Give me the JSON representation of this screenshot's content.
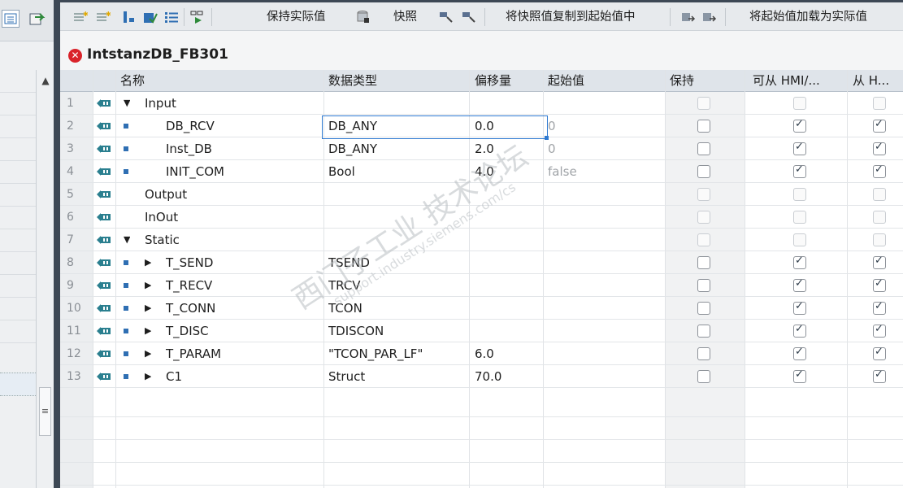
{
  "toolbar": {
    "keep_actual": "保持实际值",
    "snapshot": "快照",
    "copy_snapshot": "将快照值复制到起始值中",
    "load_start": "将起始值加载为实际值"
  },
  "block": {
    "title": "IntstanzDB_FB301",
    "status": "error"
  },
  "table": {
    "headers": {
      "name": "名称",
      "datatype": "数据类型",
      "offset": "偏移量",
      "start": "起始值",
      "retain": "保持",
      "hmi_access": "可从 HMI/...",
      "hmi_visible": "从 H..."
    },
    "rows": [
      {
        "num": "1",
        "name": "Input",
        "type": "",
        "offset": "",
        "start": "",
        "level": 0,
        "expand": "open",
        "bullet": false,
        "cbs": [
          false,
          false,
          false
        ],
        "enabled": false
      },
      {
        "num": "2",
        "name": "DB_RCV",
        "type": "DB_ANY",
        "offset": "0.0",
        "start": "0",
        "level": 1,
        "expand": "none",
        "bullet": true,
        "cbs": [
          false,
          true,
          true
        ],
        "enabled": true
      },
      {
        "num": "3",
        "name": "Inst_DB",
        "type": "DB_ANY",
        "offset": "2.0",
        "start": "0",
        "level": 1,
        "expand": "none",
        "bullet": true,
        "cbs": [
          false,
          true,
          true
        ],
        "enabled": true
      },
      {
        "num": "4",
        "name": "INIT_COM",
        "type": "Bool",
        "offset": "4.0",
        "start": "false",
        "level": 1,
        "expand": "none",
        "bullet": true,
        "cbs": [
          false,
          true,
          true
        ],
        "enabled": true
      },
      {
        "num": "5",
        "name": "Output",
        "type": "",
        "offset": "",
        "start": "",
        "level": 0,
        "expand": "none",
        "bullet": false,
        "cbs": [
          false,
          false,
          false
        ],
        "enabled": false
      },
      {
        "num": "6",
        "name": "InOut",
        "type": "",
        "offset": "",
        "start": "",
        "level": 0,
        "expand": "none",
        "bullet": false,
        "cbs": [
          false,
          false,
          false
        ],
        "enabled": false
      },
      {
        "num": "7",
        "name": "Static",
        "type": "",
        "offset": "",
        "start": "",
        "level": 0,
        "expand": "open",
        "bullet": false,
        "cbs": [
          false,
          false,
          false
        ],
        "enabled": false
      },
      {
        "num": "8",
        "name": "T_SEND",
        "type": "TSEND",
        "offset": "",
        "start": "",
        "level": 1,
        "expand": "closed",
        "bullet": true,
        "cbs": [
          false,
          true,
          true
        ],
        "enabled": true
      },
      {
        "num": "9",
        "name": "T_RECV",
        "type": "TRCV",
        "offset": "",
        "start": "",
        "level": 1,
        "expand": "closed",
        "bullet": true,
        "cbs": [
          false,
          true,
          true
        ],
        "enabled": true
      },
      {
        "num": "10",
        "name": "T_CONN",
        "type": "TCON",
        "offset": "",
        "start": "",
        "level": 1,
        "expand": "closed",
        "bullet": true,
        "cbs": [
          false,
          true,
          true
        ],
        "enabled": true
      },
      {
        "num": "11",
        "name": "T_DISC",
        "type": "TDISCON",
        "offset": "",
        "start": "",
        "level": 1,
        "expand": "closed",
        "bullet": true,
        "cbs": [
          false,
          true,
          true
        ],
        "enabled": true
      },
      {
        "num": "12",
        "name": "T_PARAM",
        "type": "\"TCON_PAR_LF\"",
        "offset": "6.0",
        "start": "",
        "level": 1,
        "expand": "closed",
        "bullet": true,
        "cbs": [
          false,
          true,
          true
        ],
        "enabled": true
      },
      {
        "num": "13",
        "name": "C1",
        "type": "Struct",
        "offset": "70.0",
        "start": "",
        "level": 1,
        "expand": "closed",
        "bullet": true,
        "cbs": [
          false,
          true,
          true
        ],
        "enabled": true
      }
    ]
  },
  "watermark": {
    "line1": "西门子工业 技术论坛",
    "line2": "support.industry.siemens.com/cs"
  },
  "colors": {
    "accent": "#2f7ad1",
    "error": "#d9232a",
    "header_bg": "#dfe4ea"
  }
}
